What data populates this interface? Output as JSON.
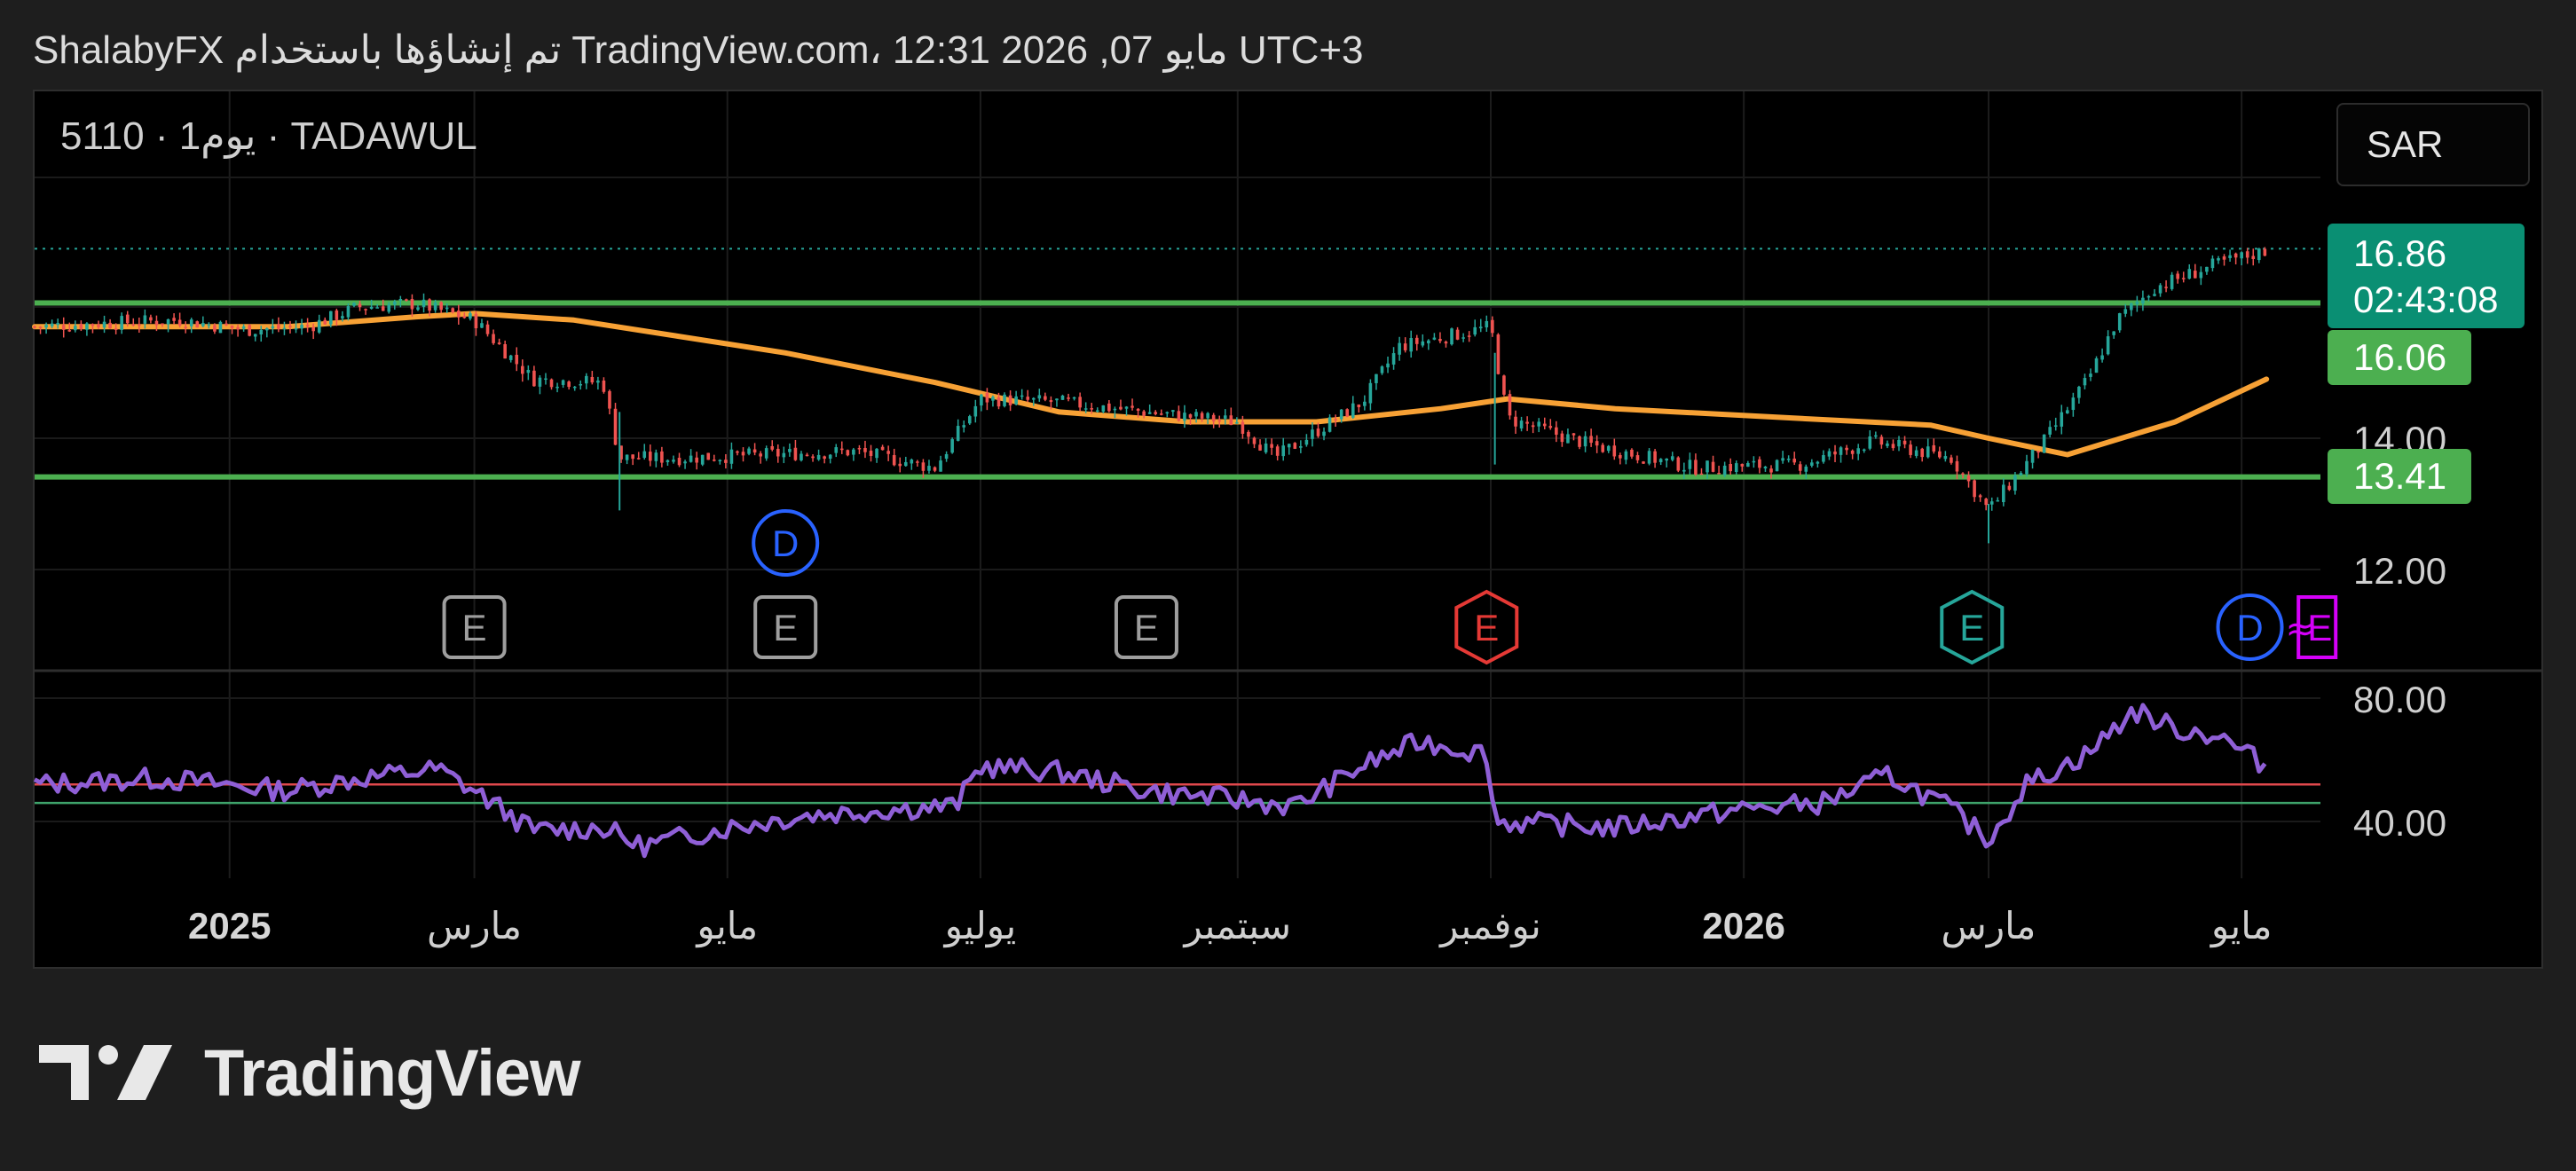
{
  "header": {
    "text": "ShalabyFX تم إنشاؤها باستخدام TradingView.com، 12:31 2026 ,07 مايو UTC+3"
  },
  "symbol": {
    "title": "5110 · 1يوم · TADAWUL"
  },
  "currency_button": "SAR",
  "brand": {
    "name": "TradingView"
  },
  "colors": {
    "background": "#000000",
    "page": "#1e1e1e",
    "candle_up": "#26a69a",
    "candle_down": "#ef5350",
    "ma_line": "#f7a135",
    "support_resistance": "#4caf50",
    "rsi_line": "#8f5fd6",
    "rsi_upper_band": "#e0484c",
    "rsi_lower_band": "#3ea36b",
    "price_label_current": "#0a8f73",
    "price_label_level": "#4caf50"
  },
  "chart_data": {
    "type": "candlestick",
    "symbol": "5110",
    "exchange": "TADAWUL",
    "interval": "1يوم",
    "currency": "SAR",
    "x_tick_labels": [
      "2025",
      "مارس",
      "مايو",
      "يوليو",
      "سبتمبر",
      "نوفمبر",
      "2026",
      "مارس",
      "مايو"
    ],
    "x_tick_dates": [
      "2025-01-01",
      "2025-03-01",
      "2025-05-01",
      "2025-07-01",
      "2025-09-01",
      "2025-11-01",
      "2026-01-01",
      "2026-03-01",
      "2026-05-01"
    ],
    "x_range": [
      "2024-11-15",
      "2026-05-20"
    ],
    "y_tick_labels": [
      "12.00",
      "14.00"
    ],
    "y_range": [
      10.4,
      18.6
    ],
    "price_labels": {
      "current_price": "16.86",
      "countdown": "02:43:08",
      "resistance": "16.06",
      "support": "13.41"
    },
    "horizontal_levels": [
      16.06,
      13.41
    ],
    "current_price": 16.86,
    "price_series": [
      {
        "date": "2024-11-15",
        "close": 15.7
      },
      {
        "date": "2024-12-01",
        "close": 15.75
      },
      {
        "date": "2024-12-20",
        "close": 15.8
      },
      {
        "date": "2025-01-05",
        "close": 15.65
      },
      {
        "date": "2025-01-20",
        "close": 15.7
      },
      {
        "date": "2025-02-01",
        "close": 16.0
      },
      {
        "date": "2025-02-15",
        "close": 16.05
      },
      {
        "date": "2025-03-01",
        "close": 15.8
      },
      {
        "date": "2025-03-15",
        "close": 14.9
      },
      {
        "date": "2025-04-01",
        "close": 14.85
      },
      {
        "date": "2025-04-05",
        "close": 13.7
      },
      {
        "date": "2025-04-20",
        "close": 13.7
      },
      {
        "date": "2025-05-10",
        "close": 13.75
      },
      {
        "date": "2025-06-01",
        "close": 13.8
      },
      {
        "date": "2025-06-20",
        "close": 13.55
      },
      {
        "date": "2025-07-01",
        "close": 14.6
      },
      {
        "date": "2025-07-20",
        "close": 14.55
      },
      {
        "date": "2025-08-10",
        "close": 14.4
      },
      {
        "date": "2025-09-01",
        "close": 14.25
      },
      {
        "date": "2025-09-10",
        "close": 13.7
      },
      {
        "date": "2025-10-01",
        "close": 14.55
      },
      {
        "date": "2025-10-10",
        "close": 15.4
      },
      {
        "date": "2025-10-25",
        "close": 15.6
      },
      {
        "date": "2025-11-01",
        "close": 15.7
      },
      {
        "date": "2025-11-05",
        "close": 14.3
      },
      {
        "date": "2025-11-25",
        "close": 13.9
      },
      {
        "date": "2025-12-20",
        "close": 13.55
      },
      {
        "date": "2026-01-15",
        "close": 13.6
      },
      {
        "date": "2026-02-01",
        "close": 13.95
      },
      {
        "date": "2026-02-20",
        "close": 13.7
      },
      {
        "date": "2026-03-01",
        "close": 12.9
      },
      {
        "date": "2026-03-15",
        "close": 14.0
      },
      {
        "date": "2026-03-25",
        "close": 14.9
      },
      {
        "date": "2026-04-01",
        "close": 15.8
      },
      {
        "date": "2026-04-10",
        "close": 16.3
      },
      {
        "date": "2026-04-25",
        "close": 16.65
      },
      {
        "date": "2026-05-07",
        "close": 16.86
      }
    ],
    "moving_average": [
      {
        "date": "2024-11-15",
        "value": 15.7
      },
      {
        "date": "2025-01-15",
        "value": 15.7
      },
      {
        "date": "2025-02-15",
        "value": 15.85
      },
      {
        "date": "2025-03-01",
        "value": 15.9
      },
      {
        "date": "2025-03-25",
        "value": 15.8
      },
      {
        "date": "2025-05-15",
        "value": 15.3
      },
      {
        "date": "2025-06-20",
        "value": 14.85
      },
      {
        "date": "2025-07-20",
        "value": 14.4
      },
      {
        "date": "2025-08-20",
        "value": 14.25
      },
      {
        "date": "2025-09-20",
        "value": 14.25
      },
      {
        "date": "2025-10-20",
        "value": 14.45
      },
      {
        "date": "2025-11-05",
        "value": 14.6
      },
      {
        "date": "2025-12-01",
        "value": 14.45
      },
      {
        "date": "2026-01-15",
        "value": 14.3
      },
      {
        "date": "2026-02-15",
        "value": 14.2
      },
      {
        "date": "2026-03-01",
        "value": 14.0
      },
      {
        "date": "2026-03-20",
        "value": 13.75
      },
      {
        "date": "2026-04-15",
        "value": 14.25
      },
      {
        "date": "2026-05-07",
        "value": 14.9
      }
    ],
    "event_markers": [
      {
        "type": "E",
        "date": "2025-03-01",
        "style": "past"
      },
      {
        "type": "E",
        "date": "2025-05-15",
        "style": "past"
      },
      {
        "type": "E",
        "date": "2025-08-10",
        "style": "past"
      },
      {
        "type": "E",
        "date": "2025-10-31",
        "style": "miss"
      },
      {
        "type": "E",
        "date": "2026-02-25",
        "style": "beat"
      },
      {
        "type": "D",
        "date": "2025-05-15",
        "style": "dividend"
      },
      {
        "type": "D",
        "date": "2026-05-07",
        "style": "dividend"
      },
      {
        "type": "E",
        "date": "2026-05-18",
        "style": "upcoming"
      }
    ],
    "rsi": {
      "y_tick_labels": [
        "80.00",
        "40.00"
      ],
      "y_range": [
        14,
        98
      ],
      "upper_band": 52,
      "lower_band": 46,
      "series": [
        {
          "date": "2024-11-15",
          "value": 52
        },
        {
          "date": "2024-12-15",
          "value": 54
        },
        {
          "date": "2025-01-15",
          "value": 50
        },
        {
          "date": "2025-02-01",
          "value": 54
        },
        {
          "date": "2025-02-20",
          "value": 57
        },
        {
          "date": "2025-03-01",
          "value": 50
        },
        {
          "date": "2025-03-15",
          "value": 37
        },
        {
          "date": "2025-04-01",
          "value": 38
        },
        {
          "date": "2025-04-10",
          "value": 32
        },
        {
          "date": "2025-05-01",
          "value": 38
        },
        {
          "date": "2025-05-20",
          "value": 42
        },
        {
          "date": "2025-06-10",
          "value": 44
        },
        {
          "date": "2025-06-25",
          "value": 45
        },
        {
          "date": "2025-07-01",
          "value": 58
        },
        {
          "date": "2025-07-20",
          "value": 56
        },
        {
          "date": "2025-08-10",
          "value": 50
        },
        {
          "date": "2025-09-01",
          "value": 47
        },
        {
          "date": "2025-09-15",
          "value": 45
        },
        {
          "date": "2025-10-01",
          "value": 58
        },
        {
          "date": "2025-10-15",
          "value": 66
        },
        {
          "date": "2025-10-31",
          "value": 62
        },
        {
          "date": "2025-11-02",
          "value": 40
        },
        {
          "date": "2025-12-01",
          "value": 38
        },
        {
          "date": "2026-01-01",
          "value": 44
        },
        {
          "date": "2026-01-20",
          "value": 46
        },
        {
          "date": "2026-02-05",
          "value": 55
        },
        {
          "date": "2026-02-20",
          "value": 44
        },
        {
          "date": "2026-03-01",
          "value": 34
        },
        {
          "date": "2026-03-10",
          "value": 52
        },
        {
          "date": "2026-03-25",
          "value": 62
        },
        {
          "date": "2026-04-05",
          "value": 76
        },
        {
          "date": "2026-04-15",
          "value": 70
        },
        {
          "date": "2026-04-25",
          "value": 68
        },
        {
          "date": "2026-05-07",
          "value": 58
        }
      ]
    }
  }
}
